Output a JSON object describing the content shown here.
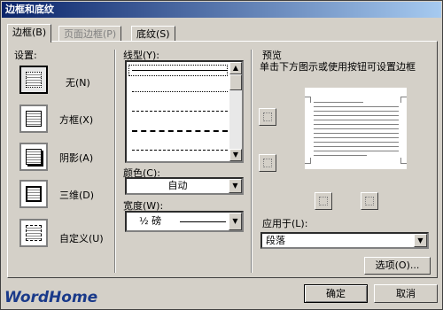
{
  "dialog": {
    "title": "边框和底纹"
  },
  "tabs": [
    {
      "label": "边框(B)",
      "active": true
    },
    {
      "label": "页面边框(P)",
      "disabled": true
    },
    {
      "label": "底纹(S)"
    }
  ],
  "settings": {
    "heading": "设置:",
    "items": [
      {
        "label": "无(N)"
      },
      {
        "label": "方框(X)"
      },
      {
        "label": "阴影(A)"
      },
      {
        "label": "三维(D)"
      },
      {
        "label": "自定义(U)"
      }
    ]
  },
  "style": {
    "heading": "线型(Y):",
    "color_label": "颜色(C):",
    "color_value": "自动",
    "width_label": "宽度(W):",
    "width_value": "½ 磅"
  },
  "preview": {
    "heading": "预览",
    "hint": "单击下方图示或使用按钮可设置边框",
    "apply_label": "应用于(L):",
    "apply_value": "段落"
  },
  "buttons": {
    "options": "选项(O)...",
    "ok": "确定",
    "cancel": "取消"
  },
  "watermark": "WordHome"
}
